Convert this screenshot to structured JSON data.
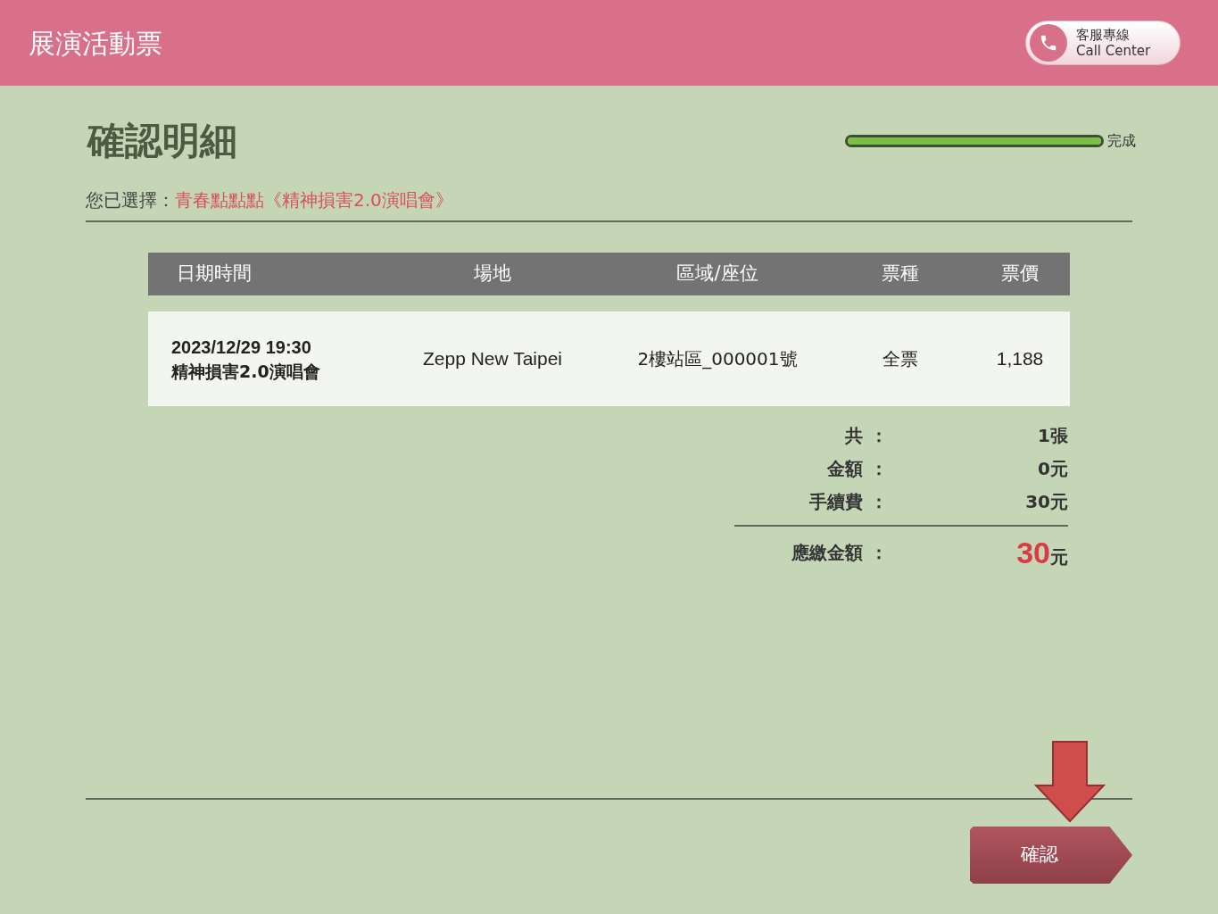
{
  "header": {
    "title": "展演活動票",
    "call_center": {
      "label_zh": "客服專線",
      "label_en": "Call Center"
    }
  },
  "page_title": "確認明細",
  "progress": {
    "level": 1,
    "label": "完成"
  },
  "selection": {
    "label": "您已選擇：",
    "value": "青春點點點《精神損害2.0演唱會》"
  },
  "table": {
    "columns": [
      "日期時間",
      "場地",
      "區域/座位",
      "票種",
      "票價"
    ],
    "rows": [
      {
        "date": "2023/12/29 19:30",
        "event": "精神損害2.0演唱會",
        "venue": "Zepp New Taipei",
        "seat": "2樓站區_000001號",
        "ticket_type": "全票",
        "price": "1,188"
      }
    ]
  },
  "summary": [
    {
      "label": "共：",
      "value": "1張"
    },
    {
      "label": "金額：",
      "value": "0元"
    },
    {
      "label": "手續費：",
      "value": "30元"
    }
  ],
  "total": {
    "label": "應繳金額：",
    "amount": "30",
    "unit": "元"
  },
  "confirm_button": "確認"
}
